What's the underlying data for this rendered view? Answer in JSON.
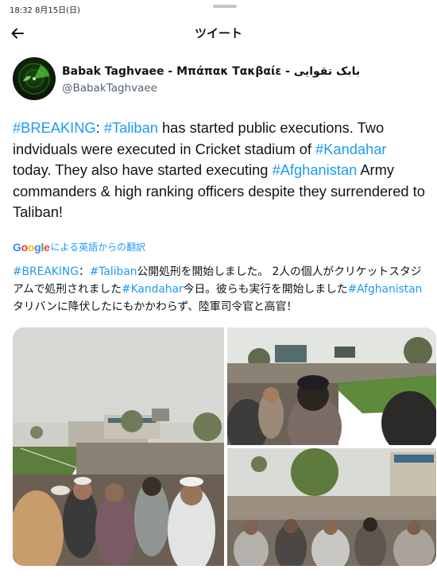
{
  "status_bar": {
    "time": "18:32  8月15日(日)"
  },
  "header": {
    "title": "ツイート"
  },
  "author": {
    "name": "Babak Taghvaee - Μπάπακ Τακβαίε - بابک تقوایی",
    "handle": "@BabakTaghvaee"
  },
  "tweet": {
    "tag_breaking": "#BREAKING",
    "t1": ": ",
    "tag_taliban": "#Taliban",
    "t2": " has started public executions. Two indviduals were executed in Cricket stadium of ",
    "tag_kandahar": "#Kandahar",
    "t3": " today. They also have started executing ",
    "tag_afghanistan": "#Afghanistan",
    "t4": " Army commanders & high ranking officers despite they surrendered to Taliban!"
  },
  "translate": {
    "label": "による英語からの翻訳"
  },
  "translation": {
    "tag_breaking": "#BREAKING",
    "t1": "：",
    "tag_taliban": "#Taliban",
    "t2": "公開処刑を開始しました。 2人の個人がクリケットスタジアムで処刑されました",
    "tag_kandahar": "#Kandahar",
    "t3": "今日。彼らも実行を開始しました",
    "tag_afghanistan": "#Afghanistan",
    "t4": "タリバンに降伏したにもかかわらず、陸軍司令官と高官！"
  },
  "icons": {
    "back": "arrow-left-icon",
    "logo": "google-logo"
  },
  "colors": {
    "link": "#1d9bf0",
    "text": "#0f1419",
    "secondary": "#536471"
  }
}
